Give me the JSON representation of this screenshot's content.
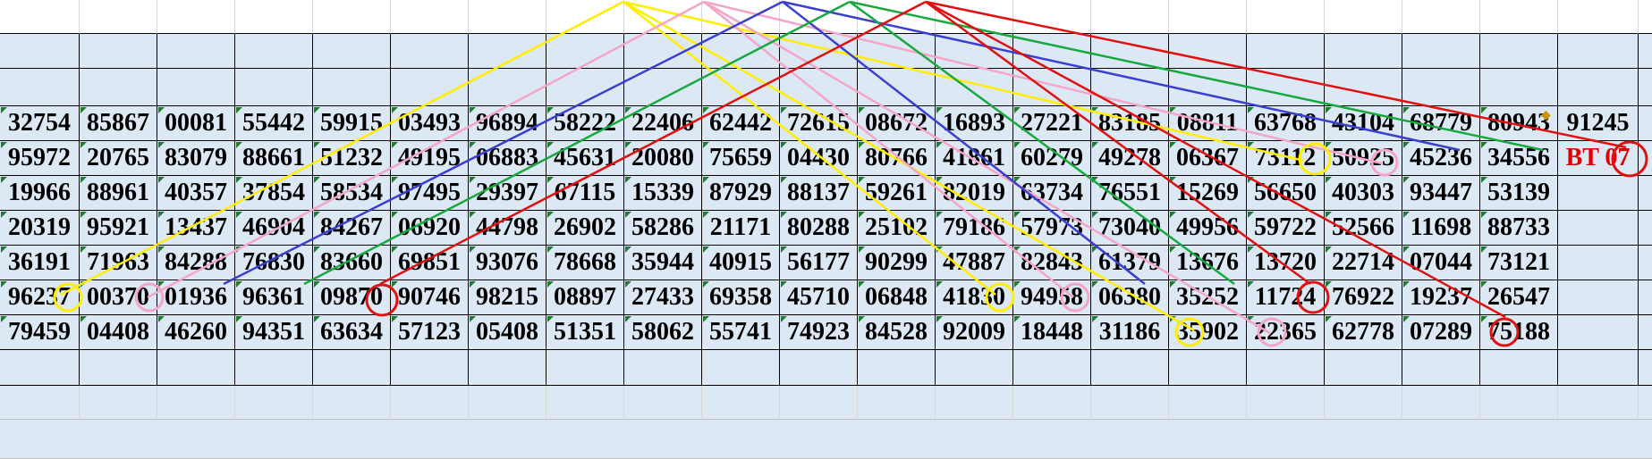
{
  "sheet": {
    "rows": [
      [
        "32754",
        "85867",
        "00081",
        "55442",
        "59915",
        "03493",
        "96894",
        "58222",
        "22406",
        "62442",
        "72615",
        "08672",
        "16893",
        "27221",
        "83185",
        "08811",
        "63768",
        "43104",
        "68779",
        "80943",
        "91245"
      ],
      [
        "95972",
        "20765",
        "83079",
        "88661",
        "51232",
        "49195",
        "06883",
        "45631",
        "20080",
        "75659",
        "04430",
        "80766",
        "41861",
        "60279",
        "49278",
        "06367",
        "73112",
        "50925",
        "45236",
        "34556",
        "BT 07"
      ],
      [
        "19966",
        "88961",
        "40357",
        "37854",
        "58534",
        "97495",
        "29397",
        "67115",
        "15339",
        "87929",
        "88137",
        "59261",
        "82019",
        "63734",
        "76551",
        "15269",
        "56650",
        "40303",
        "93447",
        "53139",
        ""
      ],
      [
        "20319",
        "95921",
        "13437",
        "46904",
        "84267",
        "06920",
        "44798",
        "26902",
        "58286",
        "21171",
        "80288",
        "25102",
        "79186",
        "57973",
        "73040",
        "49956",
        "59722",
        "52566",
        "11698",
        "88733",
        ""
      ],
      [
        "36191",
        "71963",
        "84288",
        "76830",
        "83660",
        "69851",
        "93076",
        "78668",
        "35944",
        "40915",
        "56177",
        "90299",
        "47887",
        "82843",
        "61379",
        "13676",
        "13720",
        "22714",
        "07044",
        "73121",
        ""
      ],
      [
        "96237",
        "00370",
        "01936",
        "96361",
        "09870",
        "90746",
        "98215",
        "08897",
        "27433",
        "69358",
        "45710",
        "06848",
        "41830",
        "94958",
        "06380",
        "35252",
        "11724",
        "76922",
        "19237",
        "26547",
        ""
      ],
      [
        "79459",
        "04408",
        "46260",
        "94351",
        "63634",
        "57123",
        "05408",
        "51351",
        "58062",
        "55741",
        "74923",
        "84528",
        "92009",
        "18448",
        "31186",
        "35902",
        "22365",
        "62778",
        "07289",
        "75188",
        ""
      ]
    ]
  },
  "colors": {
    "cell_fill": "#dce9f5",
    "yellow_line": "#ffee00",
    "pink_line": "#f4a6c8",
    "blue_line": "#3b3fd0",
    "green_line": "#18a840",
    "red_line": "#e01010"
  },
  "icons": {
    "warning": "warning-diamond-icon"
  }
}
